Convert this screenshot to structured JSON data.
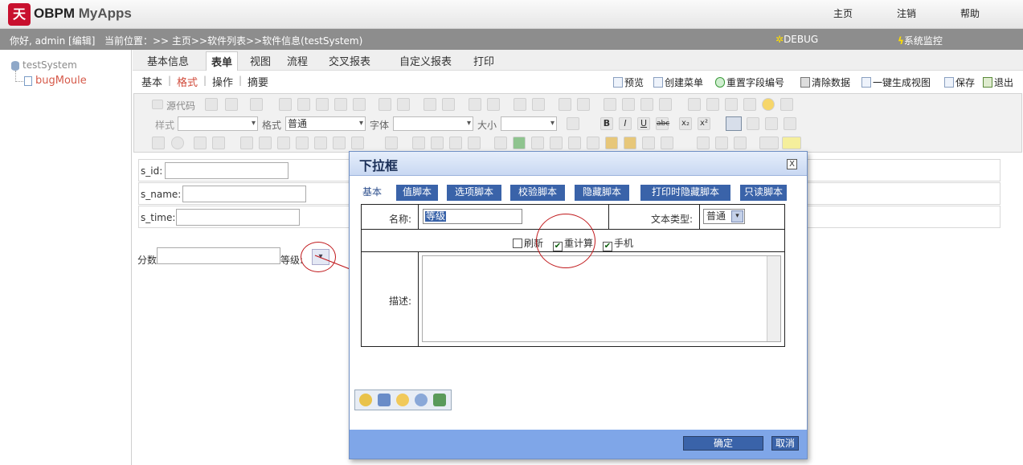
{
  "header": {
    "logo_char": "天",
    "brand_main": "OBPM",
    "brand_sub": "MyApps",
    "nav": [
      "主页",
      "注销",
      "帮助"
    ]
  },
  "statusbar": {
    "greeting": "你好, admin [编辑]",
    "location": "当前位置：>> 主页>>软件列表>>软件信息(testSystem)",
    "debug": "DEBUG",
    "monitor": "系统监控"
  },
  "tree": {
    "root": "testSystem",
    "child": "bugMoule"
  },
  "maintabs": [
    "基本信息",
    "表单",
    "视图",
    "流程",
    "交叉报表",
    "自定义报表",
    "打印"
  ],
  "subtabs": [
    "基本",
    "格式",
    "操作",
    "摘要"
  ],
  "actions": [
    "预览",
    "创建菜单",
    "重置字段编号",
    "清除数据",
    "一键生成视图",
    "保存",
    "退出"
  ],
  "toolbar": {
    "source_label": "源代码",
    "style_label": "样式",
    "format_label": "格式",
    "format_value": "普通",
    "font_label": "字体",
    "size_label": "大小"
  },
  "form": {
    "fields": [
      "s_id:",
      "s_name:",
      "s_time:"
    ],
    "score_label": "分数",
    "level_label": "等级:"
  },
  "dialog": {
    "title": "下拉框",
    "close": "X",
    "tabs": [
      "基本",
      "值脚本",
      "选项脚本",
      "校验脚本",
      "隐藏脚本",
      "打印时隐藏脚本",
      "只读脚本"
    ],
    "name_label": "名称:",
    "name_value": "等级",
    "text_type_label": "文本类型:",
    "text_type_value": "普通",
    "checkboxes": [
      {
        "label": "刷新",
        "checked": false
      },
      {
        "label": "重计算",
        "checked": true
      },
      {
        "label": "手机",
        "checked": true
      }
    ],
    "desc_label": "描述:",
    "ok": "确定",
    "cancel": "取消"
  },
  "colors": {
    "dialog_blue": "#3a63a9",
    "footer_blue": "#7fa6e8",
    "annotation_red": "#c0181b",
    "active_subtab": "#d04a3a"
  }
}
